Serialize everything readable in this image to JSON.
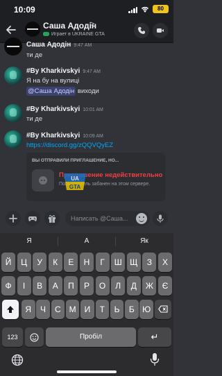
{
  "status_bar": {
    "time": "10:09",
    "battery": "80"
  },
  "header": {
    "name": "Саша Адодін",
    "chevron": ">",
    "activity": "Играет в UKRAINE GTA",
    "icons": [
      "back-arrow-icon",
      "phone-icon",
      "video-icon"
    ]
  },
  "messages": [
    {
      "author": "Саша Адодін",
      "time": "9:47 AM",
      "lines": [
        "ти де"
      ]
    },
    {
      "author": "#By Kharkivskyi",
      "time": "9:47 AM",
      "lines": [
        "Я на бу на вулиці"
      ],
      "mention": "@Саша Адодін",
      "mention_suffix": " виходи"
    },
    {
      "author": "#By Kharkivskyi",
      "time": "10:01 AM",
      "lines": [
        "ти де"
      ]
    },
    {
      "author": "#By Kharkivskyi",
      "time": "10:09 AM",
      "link": "https://discord.gg/zQQVQyEZ"
    }
  ],
  "invite": {
    "title": "ВЫ ОТПРАВИЛИ ПРИГЛАШЕНИЕ, НО...",
    "heading": "Приглашение недействительно",
    "subtext": "Пользователь забанен на этом сервере."
  },
  "composer": {
    "placeholder": "Написать @Саша..."
  },
  "keyboard": {
    "suggestions": [
      "Я",
      "А",
      "Як"
    ],
    "row1": [
      "Й",
      "Ц",
      "У",
      "К",
      "Е",
      "Н",
      "Г",
      "Ш",
      "Щ",
      "З",
      "Х"
    ],
    "row2": [
      "Ф",
      "І",
      "В",
      "А",
      "П",
      "Р",
      "О",
      "Л",
      "Д",
      "Ж",
      "Є"
    ],
    "row3": [
      "Я",
      "Ч",
      "С",
      "М",
      "И",
      "Т",
      "Ь",
      "Б",
      "Ю"
    ],
    "num_key": "123",
    "space_key": "Пробіл",
    "return_key": "↵"
  },
  "colors": {
    "background": "#313338",
    "header": "#1e1f22",
    "link": "#00a8fc",
    "error": "#f23f43",
    "mention_bg": "#3c4270",
    "battery": "#f0c419"
  }
}
